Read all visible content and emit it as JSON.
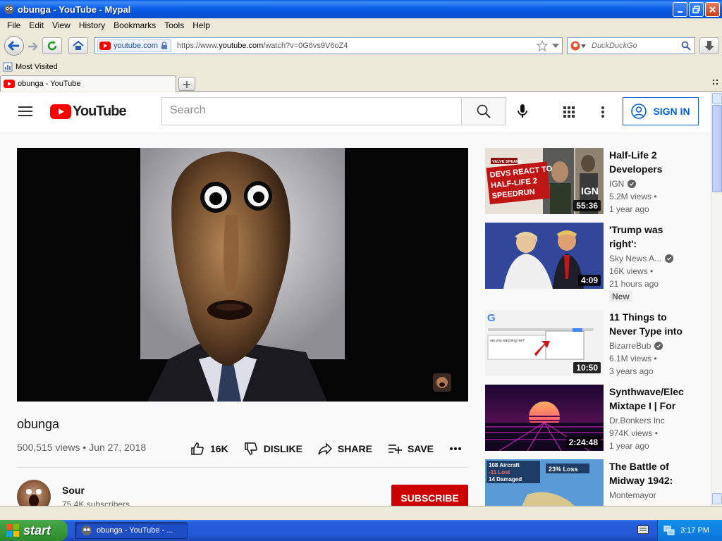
{
  "window": {
    "title": "obunga - YouTube - Mypal"
  },
  "menu": [
    "File",
    "Edit",
    "View",
    "History",
    "Bookmarks",
    "Tools",
    "Help"
  ],
  "nav": {
    "site_identity": "youtube.com",
    "url_prefix": "https://www.",
    "url_domain": "youtube.com",
    "url_path": "/watch?v=0G6vs9V6oZ4",
    "search_placeholder": "DuckDuckGo"
  },
  "bookmarks": {
    "most_visited": "Most Visited"
  },
  "tabs": [
    {
      "label": "obunga - YouTube"
    }
  ],
  "yt": {
    "logo_text": "YouTube",
    "search_placeholder": "Search",
    "signin_label": "SIGN IN"
  },
  "video": {
    "title": "obunga",
    "views": "500,515 views",
    "date": "Jun 27, 2018",
    "likes": "16K",
    "dislike_label": "DISLIKE",
    "share_label": "SHARE",
    "save_label": "SAVE",
    "channel": "Sour",
    "subscribers": "75.4K subscribers",
    "subscribe_label": "SUBSCRIBE"
  },
  "recommendations": [
    {
      "title1": "Half-Life 2",
      "title2": "Developers",
      "channel": "IGN",
      "verified": true,
      "views": "5.2M views •",
      "age": "1 year ago",
      "duration": "55:36",
      "thumb_text": [
        "DEVS REACT TO",
        "HALF-LIFE 2",
        "SPEEDRUN"
      ],
      "thumb_badge": "VALVE SPEAKS!",
      "thumb_logo": "IGN"
    },
    {
      "title1": "'Trump was",
      "title2": "right':",
      "channel": "Sky News A...",
      "verified": true,
      "views": "16K views •",
      "age": "21 hours ago",
      "duration": "4:09",
      "badge": "New"
    },
    {
      "title1": "11 Things to",
      "title2": "Never Type into",
      "channel": "BizarreBub",
      "verified": true,
      "views": "6.1M views •",
      "age": "3 years ago",
      "duration": "10:50",
      "thumb_text": [
        "are you watching me?"
      ]
    },
    {
      "title1": "Synthwave/Elec",
      "title2": "Mixtape I | For",
      "channel": "Dr.Bonkers Inc",
      "verified": false,
      "views": "974K views •",
      "age": "1 year ago",
      "duration": "2:24:48"
    },
    {
      "title1": "The Battle of",
      "title2": "Midway 1942:",
      "channel": "Montemayor",
      "verified": false,
      "thumb_text": [
        "108 Aircraft",
        "-11 Lost",
        "14 Damaged",
        "23% Loss"
      ]
    }
  ],
  "taskbar": {
    "start_label": "start",
    "task_label": "obunga - YouTube - ...",
    "clock": "3:17 PM"
  },
  "colors": {
    "yt_red": "#ff0000",
    "subscribe_red": "#cc0000",
    "signin_blue": "#065fd4",
    "xp_blue": "#0a5be0"
  }
}
